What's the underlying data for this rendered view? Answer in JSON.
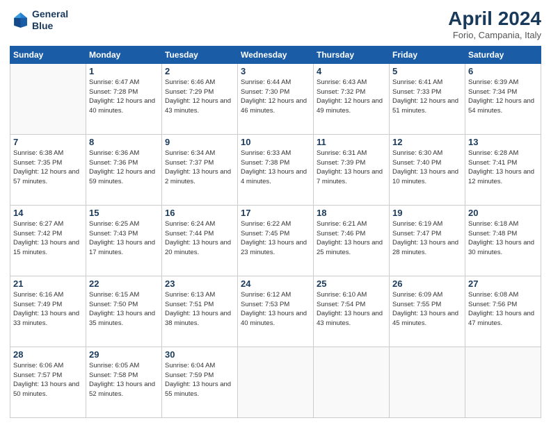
{
  "header": {
    "logo_line1": "General",
    "logo_line2": "Blue",
    "main_title": "April 2024",
    "subtitle": "Forio, Campania, Italy"
  },
  "weekdays": [
    "Sunday",
    "Monday",
    "Tuesday",
    "Wednesday",
    "Thursday",
    "Friday",
    "Saturday"
  ],
  "weeks": [
    [
      {
        "num": "",
        "sunrise": "",
        "sunset": "",
        "daylight": "",
        "empty": true
      },
      {
        "num": "1",
        "sunrise": "Sunrise: 6:47 AM",
        "sunset": "Sunset: 7:28 PM",
        "daylight": "Daylight: 12 hours and 40 minutes."
      },
      {
        "num": "2",
        "sunrise": "Sunrise: 6:46 AM",
        "sunset": "Sunset: 7:29 PM",
        "daylight": "Daylight: 12 hours and 43 minutes."
      },
      {
        "num": "3",
        "sunrise": "Sunrise: 6:44 AM",
        "sunset": "Sunset: 7:30 PM",
        "daylight": "Daylight: 12 hours and 46 minutes."
      },
      {
        "num": "4",
        "sunrise": "Sunrise: 6:43 AM",
        "sunset": "Sunset: 7:32 PM",
        "daylight": "Daylight: 12 hours and 49 minutes."
      },
      {
        "num": "5",
        "sunrise": "Sunrise: 6:41 AM",
        "sunset": "Sunset: 7:33 PM",
        "daylight": "Daylight: 12 hours and 51 minutes."
      },
      {
        "num": "6",
        "sunrise": "Sunrise: 6:39 AM",
        "sunset": "Sunset: 7:34 PM",
        "daylight": "Daylight: 12 hours and 54 minutes."
      }
    ],
    [
      {
        "num": "7",
        "sunrise": "Sunrise: 6:38 AM",
        "sunset": "Sunset: 7:35 PM",
        "daylight": "Daylight: 12 hours and 57 minutes."
      },
      {
        "num": "8",
        "sunrise": "Sunrise: 6:36 AM",
        "sunset": "Sunset: 7:36 PM",
        "daylight": "Daylight: 12 hours and 59 minutes."
      },
      {
        "num": "9",
        "sunrise": "Sunrise: 6:34 AM",
        "sunset": "Sunset: 7:37 PM",
        "daylight": "Daylight: 13 hours and 2 minutes."
      },
      {
        "num": "10",
        "sunrise": "Sunrise: 6:33 AM",
        "sunset": "Sunset: 7:38 PM",
        "daylight": "Daylight: 13 hours and 4 minutes."
      },
      {
        "num": "11",
        "sunrise": "Sunrise: 6:31 AM",
        "sunset": "Sunset: 7:39 PM",
        "daylight": "Daylight: 13 hours and 7 minutes."
      },
      {
        "num": "12",
        "sunrise": "Sunrise: 6:30 AM",
        "sunset": "Sunset: 7:40 PM",
        "daylight": "Daylight: 13 hours and 10 minutes."
      },
      {
        "num": "13",
        "sunrise": "Sunrise: 6:28 AM",
        "sunset": "Sunset: 7:41 PM",
        "daylight": "Daylight: 13 hours and 12 minutes."
      }
    ],
    [
      {
        "num": "14",
        "sunrise": "Sunrise: 6:27 AM",
        "sunset": "Sunset: 7:42 PM",
        "daylight": "Daylight: 13 hours and 15 minutes."
      },
      {
        "num": "15",
        "sunrise": "Sunrise: 6:25 AM",
        "sunset": "Sunset: 7:43 PM",
        "daylight": "Daylight: 13 hours and 17 minutes."
      },
      {
        "num": "16",
        "sunrise": "Sunrise: 6:24 AM",
        "sunset": "Sunset: 7:44 PM",
        "daylight": "Daylight: 13 hours and 20 minutes."
      },
      {
        "num": "17",
        "sunrise": "Sunrise: 6:22 AM",
        "sunset": "Sunset: 7:45 PM",
        "daylight": "Daylight: 13 hours and 23 minutes."
      },
      {
        "num": "18",
        "sunrise": "Sunrise: 6:21 AM",
        "sunset": "Sunset: 7:46 PM",
        "daylight": "Daylight: 13 hours and 25 minutes."
      },
      {
        "num": "19",
        "sunrise": "Sunrise: 6:19 AM",
        "sunset": "Sunset: 7:47 PM",
        "daylight": "Daylight: 13 hours and 28 minutes."
      },
      {
        "num": "20",
        "sunrise": "Sunrise: 6:18 AM",
        "sunset": "Sunset: 7:48 PM",
        "daylight": "Daylight: 13 hours and 30 minutes."
      }
    ],
    [
      {
        "num": "21",
        "sunrise": "Sunrise: 6:16 AM",
        "sunset": "Sunset: 7:49 PM",
        "daylight": "Daylight: 13 hours and 33 minutes."
      },
      {
        "num": "22",
        "sunrise": "Sunrise: 6:15 AM",
        "sunset": "Sunset: 7:50 PM",
        "daylight": "Daylight: 13 hours and 35 minutes."
      },
      {
        "num": "23",
        "sunrise": "Sunrise: 6:13 AM",
        "sunset": "Sunset: 7:51 PM",
        "daylight": "Daylight: 13 hours and 38 minutes."
      },
      {
        "num": "24",
        "sunrise": "Sunrise: 6:12 AM",
        "sunset": "Sunset: 7:53 PM",
        "daylight": "Daylight: 13 hours and 40 minutes."
      },
      {
        "num": "25",
        "sunrise": "Sunrise: 6:10 AM",
        "sunset": "Sunset: 7:54 PM",
        "daylight": "Daylight: 13 hours and 43 minutes."
      },
      {
        "num": "26",
        "sunrise": "Sunrise: 6:09 AM",
        "sunset": "Sunset: 7:55 PM",
        "daylight": "Daylight: 13 hours and 45 minutes."
      },
      {
        "num": "27",
        "sunrise": "Sunrise: 6:08 AM",
        "sunset": "Sunset: 7:56 PM",
        "daylight": "Daylight: 13 hours and 47 minutes."
      }
    ],
    [
      {
        "num": "28",
        "sunrise": "Sunrise: 6:06 AM",
        "sunset": "Sunset: 7:57 PM",
        "daylight": "Daylight: 13 hours and 50 minutes."
      },
      {
        "num": "29",
        "sunrise": "Sunrise: 6:05 AM",
        "sunset": "Sunset: 7:58 PM",
        "daylight": "Daylight: 13 hours and 52 minutes."
      },
      {
        "num": "30",
        "sunrise": "Sunrise: 6:04 AM",
        "sunset": "Sunset: 7:59 PM",
        "daylight": "Daylight: 13 hours and 55 minutes."
      },
      {
        "num": "",
        "sunrise": "",
        "sunset": "",
        "daylight": "",
        "empty": true
      },
      {
        "num": "",
        "sunrise": "",
        "sunset": "",
        "daylight": "",
        "empty": true
      },
      {
        "num": "",
        "sunrise": "",
        "sunset": "",
        "daylight": "",
        "empty": true
      },
      {
        "num": "",
        "sunrise": "",
        "sunset": "",
        "daylight": "",
        "empty": true
      }
    ]
  ]
}
